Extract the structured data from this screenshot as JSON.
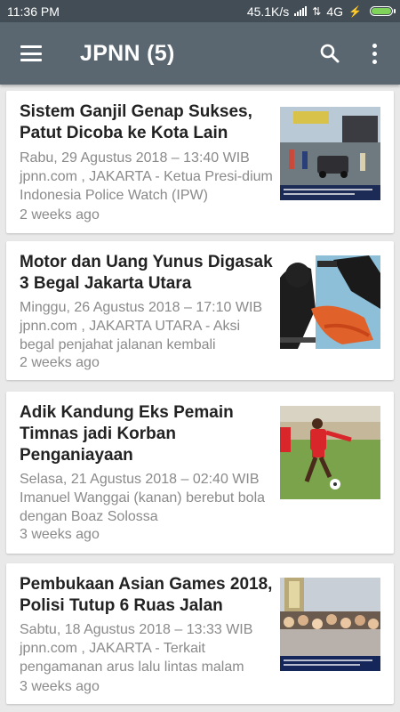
{
  "status_bar": {
    "time": "11:36 PM",
    "speed": "45.1K/s",
    "network": "4G"
  },
  "app_bar": {
    "title": "JPNN (5)",
    "icons": [
      "menu-icon",
      "search-icon",
      "more-vert-icon"
    ]
  },
  "articles": [
    {
      "title": "Sistem Ganjil Genap Sukses, Patut Dicoba ke Kota Lain",
      "snippet": "Rabu, 29 Agustus 2018 – 13:40 WIB jpnn.com , JAKARTA - Ketua Presi-dium Indonesia Police Watch (IPW)",
      "age": "2 weeks ago",
      "thumbnail": "traffic-police-photo"
    },
    {
      "title": "Motor dan Uang Yunus Digasak 3 Begal Jakarta Utara",
      "snippet": "Minggu, 26 Agustus 2018 – 17:10 WIB jpnn.com , JAKARTA UTARA - Aksi begal penjahat jalanan kembali",
      "age": "2 weeks ago",
      "thumbnail": "robbery-illustration"
    },
    {
      "title": "Adik Kandung Eks Pemain Timnas jadi Korban Penganiayaan",
      "snippet": "Selasa, 21 Agustus 2018 – 02:40 WIB Imanuel Wanggai (kanan) berebut bola dengan Boaz Solossa",
      "age": "3 weeks ago",
      "thumbnail": "football-photo"
    },
    {
      "title": "Pembukaan Asian Games 2018, Polisi Tutup 6 Ruas Jalan",
      "snippet": "Sabtu, 18 Agustus 2018 – 13:33 WIB jpnn.com , JAKARTA - Terkait pengamanan arus lalu lintas malam",
      "age": "3 weeks ago",
      "thumbnail": "crowd-photo"
    }
  ]
}
